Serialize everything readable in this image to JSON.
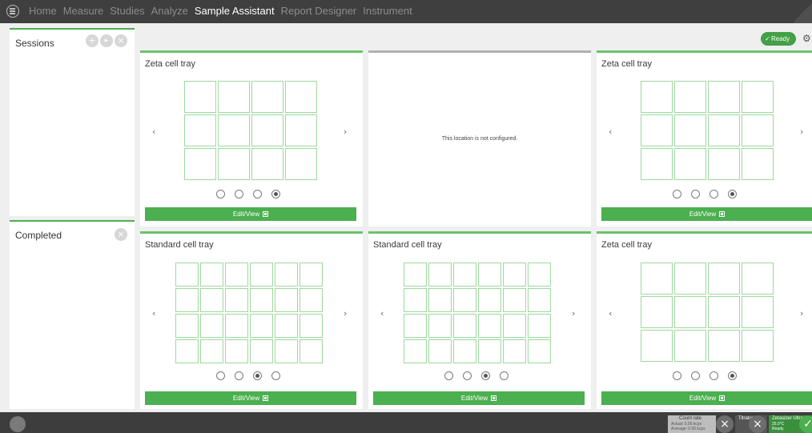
{
  "nav": {
    "items": [
      "Home",
      "Measure",
      "Studies",
      "Analyze",
      "Sample Assistant",
      "Report Designer",
      "Instrument"
    ],
    "active": "Sample Assistant"
  },
  "sidebar": {
    "sessions_title": "Sessions",
    "completed_title": "Completed",
    "add_icon": "+",
    "play_icon": "▸",
    "close_icon": "×"
  },
  "toolbar": {
    "ready_label": "Ready",
    "ready_icon": "✓",
    "gear_icon": "⚙"
  },
  "trays": [
    {
      "title": "Zeta cell tray",
      "configured": true,
      "prev": "‹",
      "next": "›",
      "dots_selected": 4,
      "button": "Edit/View"
    },
    {
      "title": "",
      "configured": false,
      "message": "This location is not configured."
    },
    {
      "title": "Zeta cell tray",
      "configured": true,
      "prev": "‹",
      "next": "›",
      "dots_selected": 4,
      "button": "Edit/View"
    },
    {
      "title": "Standard cell tray",
      "configured": true,
      "prev": "‹",
      "next": "›",
      "dots_selected": 3,
      "button": "Edit/View"
    },
    {
      "title": "Standard cell tray",
      "configured": true,
      "prev": "‹",
      "next": "›",
      "dots_selected": 3,
      "button": "Edit/View"
    },
    {
      "title": "Zeta cell tray",
      "configured": true,
      "prev": "‹",
      "next": "›",
      "dots_selected": 4,
      "button": "Edit/View"
    }
  ],
  "statusbar": {
    "count_rate": {
      "title": "Count rate",
      "line1": "Actual: 0.00 kcps",
      "line2": "Average: 0.00 kcps"
    },
    "titrator": {
      "title": "Titrator"
    },
    "instrument": {
      "title": "Zetasizer Ultra Blu",
      "line1": "25.0°C",
      "line2": "Ready"
    }
  },
  "colors": {
    "accent": "#4caf50",
    "topbar": "#3f3f3f",
    "cell_border": "#9ed89e"
  }
}
